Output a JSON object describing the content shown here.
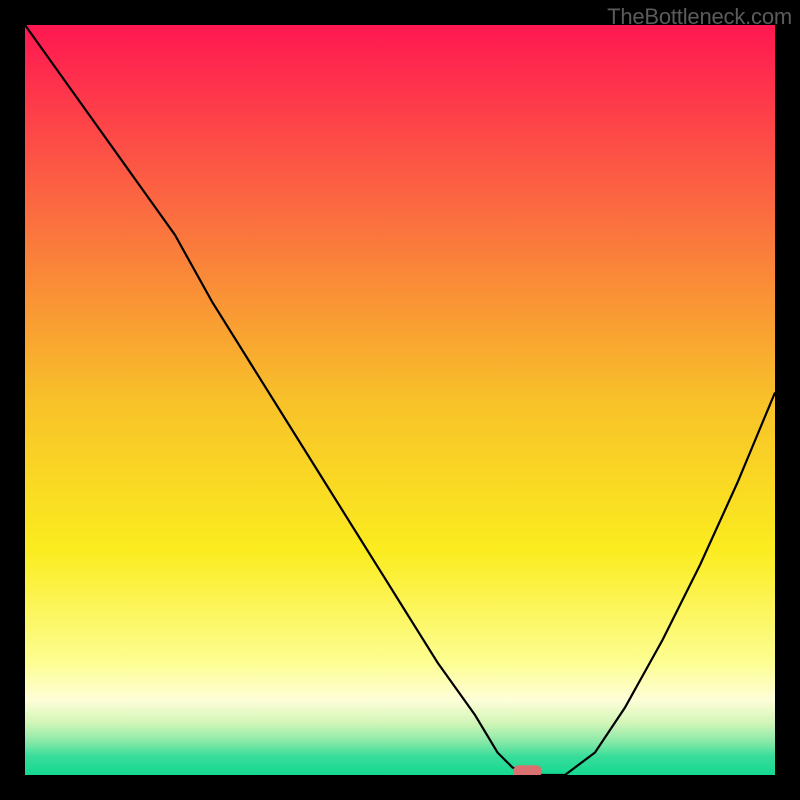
{
  "watermark": "TheBottleneck.com",
  "chart_data": {
    "type": "line",
    "title": "",
    "xlabel": "",
    "ylabel": "",
    "x_range": [
      0,
      100
    ],
    "y_range": [
      0,
      100
    ],
    "series": [
      {
        "name": "curve",
        "x": [
          0,
          5,
          10,
          15,
          20,
          25,
          30,
          35,
          40,
          45,
          50,
          55,
          60,
          63,
          65,
          68,
          72,
          76,
          80,
          85,
          90,
          95,
          100
        ],
        "y": [
          100,
          93,
          86,
          79,
          72,
          63,
          55,
          47,
          39,
          31,
          23,
          15,
          8,
          3,
          1,
          0,
          0,
          3,
          9,
          18,
          28,
          39,
          51
        ]
      }
    ],
    "marker": {
      "x": 67,
      "y": 0.5,
      "color": "#d8716f"
    },
    "background_gradient": [
      {
        "pos": 0.0,
        "color": "#ff1751"
      },
      {
        "pos": 0.25,
        "color": "#fb6c40"
      },
      {
        "pos": 0.5,
        "color": "#f8c129"
      },
      {
        "pos": 0.7,
        "color": "#fbec1f"
      },
      {
        "pos": 0.85,
        "color": "#fdfe92"
      },
      {
        "pos": 0.9,
        "color": "#fefed8"
      },
      {
        "pos": 0.93,
        "color": "#d3f6b8"
      },
      {
        "pos": 0.955,
        "color": "#8ae9a8"
      },
      {
        "pos": 0.975,
        "color": "#39dd9b"
      },
      {
        "pos": 1.0,
        "color": "#14d891"
      }
    ]
  }
}
